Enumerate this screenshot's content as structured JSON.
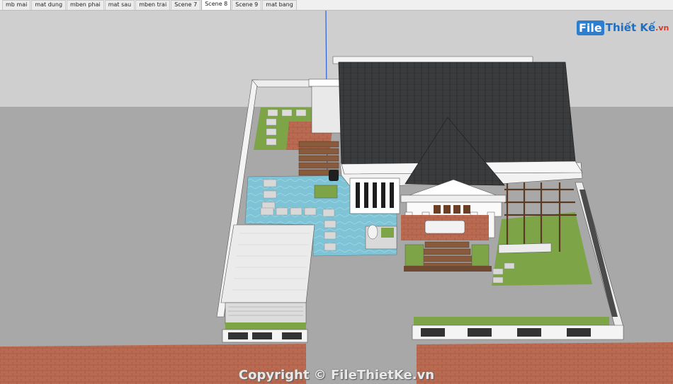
{
  "scene_tabs": [
    {
      "label": "mb mai"
    },
    {
      "label": "mat dung"
    },
    {
      "label": "mben phai"
    },
    {
      "label": "mat sau"
    },
    {
      "label": "mben trai"
    },
    {
      "label": "Scene 7"
    },
    {
      "label": "Scene 8",
      "active": true
    },
    {
      "label": "Scene 9"
    },
    {
      "label": "mat bang"
    }
  ],
  "watermark": {
    "logo_left": "File",
    "logo_right": "Thiết Kế",
    "logo_tld": ".vn",
    "copyright": "Copyright © FileThietKe.vn"
  },
  "colors": {
    "sky": "#cfcfcf",
    "ground": "#a7a7a7",
    "roof": "#3a3b3d",
    "pool": "#7fc3d6",
    "grass": "#6f9a3b",
    "pavement": "#b7664c",
    "axis": "#2f5fd8"
  },
  "icons": {
    "logo": "filethietke-logo"
  }
}
